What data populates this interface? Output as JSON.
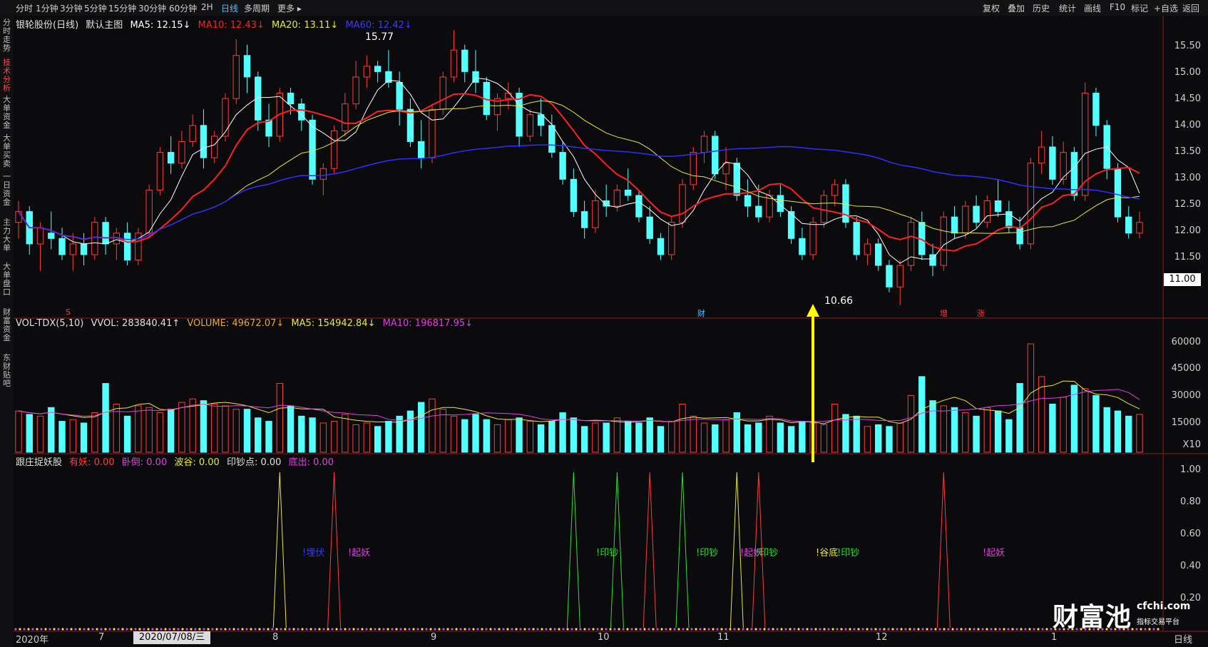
{
  "toolbar": {
    "periods": [
      "分时",
      "1分钟",
      "3分钟",
      "5分钟",
      "15分钟",
      "30分钟",
      "60分钟",
      "2H",
      "日线",
      "多周期",
      "更多 ▸"
    ],
    "active_period": "日线",
    "tools": [
      "复权",
      "叠加",
      "历史",
      "统计",
      "画线",
      "F10",
      "标记",
      "+自选",
      "返回"
    ]
  },
  "side_tabs": [
    "分时走势",
    "技术分析",
    "大单资金",
    "大单买卖",
    "一日资金",
    "主力大单",
    "大单盘口",
    "财富资金",
    "东财贴吧"
  ],
  "active_side_tab": "技术分析",
  "main_legend": {
    "title": "银轮股份(日线)",
    "template": "默认主图",
    "ma5": "MA5: 12.15↓",
    "ma10": "MA10: 12.43↓",
    "ma20": "MA20: 13.11↓",
    "ma60": "MA60: 12.42↓"
  },
  "price_axis": [
    "15.50",
    "15.00",
    "14.50",
    "14.00",
    "13.50",
    "13.00",
    "12.50",
    "12.00",
    "11.50"
  ],
  "current_price": "11.00",
  "high_label": "15.77",
  "low_label": "10.66",
  "event_markers": [
    "S",
    "财",
    "增",
    "涨"
  ],
  "volume_legend": {
    "name": "VOL-TDX(5,10)",
    "vvol": "VVOL: 283840.41↑",
    "volume": "VOLUME: 49672.07↓",
    "ma5": "MA5: 154942.84↓",
    "ma10": "MA10: 196817.95↓"
  },
  "volume_axis": [
    "60000",
    "45000",
    "30000",
    "15000"
  ],
  "volume_unit": "X10",
  "indicator_legend": {
    "name": "跟庄捉妖股",
    "youyao": "有妖: 0.00",
    "wodao": "卧倒: 0.00",
    "bogu": "波谷: 0.00",
    "yinchao": "印钞点: 0.00",
    "dichu": "底出: 0.00"
  },
  "indicator_axis": [
    "1.00",
    "0.80",
    "0.60",
    "0.40",
    "0.20"
  ],
  "signals": [
    {
      "text": "!埋伏",
      "color": "#3a3aff"
    },
    {
      "text": "!起妖",
      "color": "#e040e0"
    },
    {
      "text": "!印钞",
      "color": "#2ee02e"
    },
    {
      "text": "!印钞",
      "color": "#2ee02e"
    },
    {
      "text": "!起妖",
      "color": "#e040e0"
    },
    {
      "text": "!印钞",
      "color": "#2ee02e"
    },
    {
      "text": "!谷底",
      "color": "#e8e83a"
    },
    {
      "text": "!印钞",
      "color": "#2ee02e"
    },
    {
      "text": "!起妖",
      "color": "#e040e0"
    }
  ],
  "x_axis": [
    "2020年",
    "7",
    "8",
    "9",
    "10",
    "11",
    "12",
    "1"
  ],
  "date_box": "2020/07/08/三",
  "bottom_right": "日线",
  "logo": {
    "cn": "财富池",
    "domain": "cfchi.com",
    "sub": "指标交易平台"
  },
  "colors": {
    "up": "#ff3c3c",
    "down": "#54ffff",
    "ma5": "#ffffff",
    "ma10": "#ff2020",
    "ma20": "#e8e83a",
    "ma60": "#2f2fff",
    "volma10": "#e040e0"
  },
  "chart_data": {
    "type": "candlestick",
    "ylim": [
      10.5,
      15.8
    ],
    "ohlc": [
      [
        12.2,
        12.6,
        11.9,
        12.4
      ],
      [
        12.4,
        12.5,
        11.6,
        11.8
      ],
      [
        11.8,
        12.2,
        11.3,
        12.1
      ],
      [
        12.0,
        12.4,
        11.7,
        11.9
      ],
      [
        11.9,
        12.1,
        11.5,
        11.6
      ],
      [
        11.6,
        12.0,
        11.3,
        11.8
      ],
      [
        11.8,
        12.0,
        11.4,
        11.6
      ],
      [
        11.6,
        12.3,
        11.5,
        12.2
      ],
      [
        12.2,
        12.3,
        11.6,
        11.8
      ],
      [
        11.8,
        12.1,
        11.5,
        12.0
      ],
      [
        12.0,
        12.2,
        11.4,
        11.5
      ],
      [
        11.5,
        12.1,
        11.4,
        12.0
      ],
      [
        12.0,
        12.9,
        11.9,
        12.8
      ],
      [
        12.8,
        13.6,
        12.7,
        13.5
      ],
      [
        13.5,
        13.8,
        13.1,
        13.3
      ],
      [
        13.3,
        13.9,
        13.2,
        13.7
      ],
      [
        13.7,
        14.2,
        13.6,
        14.0
      ],
      [
        14.0,
        14.3,
        13.2,
        13.4
      ],
      [
        13.4,
        13.9,
        13.3,
        13.8
      ],
      [
        13.8,
        14.6,
        13.7,
        14.5
      ],
      [
        14.5,
        15.6,
        14.4,
        15.3
      ],
      [
        15.3,
        15.5,
        14.6,
        14.9
      ],
      [
        14.9,
        15.0,
        13.9,
        14.1
      ],
      [
        14.1,
        14.4,
        13.6,
        13.8
      ],
      [
        13.8,
        14.7,
        13.7,
        14.6
      ],
      [
        14.6,
        14.7,
        14.2,
        14.4
      ],
      [
        14.4,
        14.5,
        13.9,
        14.1
      ],
      [
        14.1,
        14.2,
        12.9,
        13.0
      ],
      [
        13.0,
        13.3,
        12.7,
        13.2
      ],
      [
        13.2,
        14.0,
        13.1,
        13.9
      ],
      [
        13.9,
        14.6,
        13.8,
        14.4
      ],
      [
        14.4,
        15.2,
        14.3,
        14.9
      ],
      [
        14.9,
        15.3,
        14.7,
        15.1
      ],
      [
        15.1,
        15.2,
        14.8,
        15.0
      ],
      [
        15.0,
        15.4,
        14.7,
        14.8
      ],
      [
        14.8,
        15.0,
        14.0,
        14.3
      ],
      [
        14.3,
        14.5,
        13.6,
        13.7
      ],
      [
        13.7,
        14.1,
        13.2,
        13.4
      ],
      [
        13.4,
        14.4,
        13.3,
        14.3
      ],
      [
        14.3,
        15.0,
        14.2,
        14.9
      ],
      [
        14.9,
        15.77,
        14.8,
        15.4
      ],
      [
        15.4,
        15.5,
        14.8,
        15.0
      ],
      [
        15.0,
        15.4,
        14.6,
        14.8
      ],
      [
        14.8,
        14.9,
        14.1,
        14.2
      ],
      [
        14.2,
        14.6,
        13.9,
        14.5
      ],
      [
        14.5,
        14.8,
        14.3,
        14.6
      ],
      [
        14.6,
        14.7,
        13.6,
        13.8
      ],
      [
        13.8,
        14.3,
        13.7,
        14.2
      ],
      [
        14.2,
        14.5,
        13.8,
        14.0
      ],
      [
        14.0,
        14.2,
        13.4,
        13.5
      ],
      [
        13.5,
        13.7,
        12.9,
        13.0
      ],
      [
        13.0,
        13.2,
        12.3,
        12.4
      ],
      [
        12.4,
        12.6,
        11.9,
        12.1
      ],
      [
        12.1,
        12.8,
        12.0,
        12.6
      ],
      [
        12.6,
        12.9,
        12.3,
        12.5
      ],
      [
        12.5,
        12.9,
        12.4,
        12.8
      ],
      [
        12.8,
        13.2,
        12.6,
        12.7
      ],
      [
        12.7,
        12.8,
        12.2,
        12.3
      ],
      [
        12.3,
        12.5,
        11.8,
        11.9
      ],
      [
        11.9,
        12.0,
        11.5,
        11.6
      ],
      [
        11.6,
        12.3,
        11.5,
        12.2
      ],
      [
        12.2,
        13.0,
        12.1,
        12.9
      ],
      [
        12.9,
        13.6,
        12.8,
        13.5
      ],
      [
        13.5,
        13.9,
        13.3,
        13.8
      ],
      [
        13.8,
        13.9,
        13.0,
        13.1
      ],
      [
        13.1,
        13.6,
        12.8,
        13.3
      ],
      [
        13.3,
        13.4,
        12.6,
        12.7
      ],
      [
        12.7,
        13.0,
        12.3,
        12.5
      ],
      [
        12.5,
        12.9,
        12.2,
        12.3
      ],
      [
        12.3,
        12.8,
        12.2,
        12.7
      ],
      [
        12.7,
        12.9,
        12.3,
        12.4
      ],
      [
        12.4,
        12.5,
        11.8,
        11.9
      ],
      [
        11.9,
        12.1,
        11.5,
        11.6
      ],
      [
        11.6,
        12.3,
        11.5,
        12.2
      ],
      [
        12.2,
        12.8,
        12.1,
        12.7
      ],
      [
        12.7,
        13.0,
        12.5,
        12.9
      ],
      [
        12.9,
        13.0,
        12.1,
        12.2
      ],
      [
        12.2,
        12.3,
        11.5,
        11.6
      ],
      [
        11.6,
        11.9,
        11.4,
        11.8
      ],
      [
        11.8,
        11.9,
        11.3,
        11.4
      ],
      [
        11.4,
        11.5,
        10.9,
        11.0
      ],
      [
        11.0,
        11.5,
        10.66,
        11.4
      ],
      [
        11.4,
        12.3,
        11.3,
        12.2
      ],
      [
        12.2,
        12.4,
        11.5,
        11.6
      ],
      [
        11.6,
        11.8,
        11.2,
        11.4
      ],
      [
        11.4,
        12.4,
        11.3,
        12.3
      ],
      [
        12.3,
        12.5,
        11.9,
        12.0
      ],
      [
        12.0,
        12.6,
        11.9,
        12.5
      ],
      [
        12.5,
        12.7,
        12.1,
        12.2
      ],
      [
        12.2,
        12.7,
        12.1,
        12.6
      ],
      [
        12.6,
        13.0,
        12.3,
        12.4
      ],
      [
        12.4,
        12.6,
        12.0,
        12.1
      ],
      [
        12.1,
        12.3,
        11.7,
        11.8
      ],
      [
        11.8,
        13.4,
        11.7,
        13.3
      ],
      [
        13.3,
        13.9,
        13.1,
        13.6
      ],
      [
        13.6,
        13.8,
        12.9,
        13.0
      ],
      [
        13.0,
        13.7,
        12.9,
        13.5
      ],
      [
        13.5,
        13.6,
        12.6,
        12.7
      ],
      [
        12.7,
        14.8,
        12.6,
        14.6
      ],
      [
        14.6,
        14.7,
        13.8,
        14.0
      ],
      [
        14.0,
        14.1,
        13.0,
        13.2
      ],
      [
        13.2,
        13.3,
        12.2,
        12.3
      ],
      [
        12.3,
        12.5,
        11.9,
        12.0
      ],
      [
        12.0,
        12.4,
        11.9,
        12.2
      ]
    ],
    "volume": [
      24,
      22,
      21,
      26,
      18,
      19,
      17,
      23,
      40,
      28,
      21,
      27,
      26,
      23,
      25,
      29,
      31,
      30,
      28,
      27,
      25,
      25,
      20,
      18,
      40,
      27,
      21,
      20,
      17,
      18,
      22,
      16,
      17,
      15,
      18,
      21,
      24,
      29,
      31,
      25,
      21,
      19,
      22,
      19,
      16,
      19,
      20,
      18,
      16,
      18,
      23,
      20,
      15,
      17,
      17,
      20,
      18,
      17,
      20,
      15,
      18,
      28,
      21,
      17,
      16,
      19,
      23,
      16,
      17,
      21,
      17,
      15,
      18,
      17,
      16,
      28,
      22,
      21,
      15,
      16,
      15,
      17,
      33,
      44,
      30,
      27,
      26,
      23,
      21,
      26,
      24,
      19,
      40,
      63,
      44,
      28,
      32,
      39,
      37,
      33,
      26,
      24,
      21,
      22
    ],
    "signals_x_index": [
      24,
      29,
      51,
      55,
      58,
      61,
      66,
      68,
      85
    ]
  }
}
